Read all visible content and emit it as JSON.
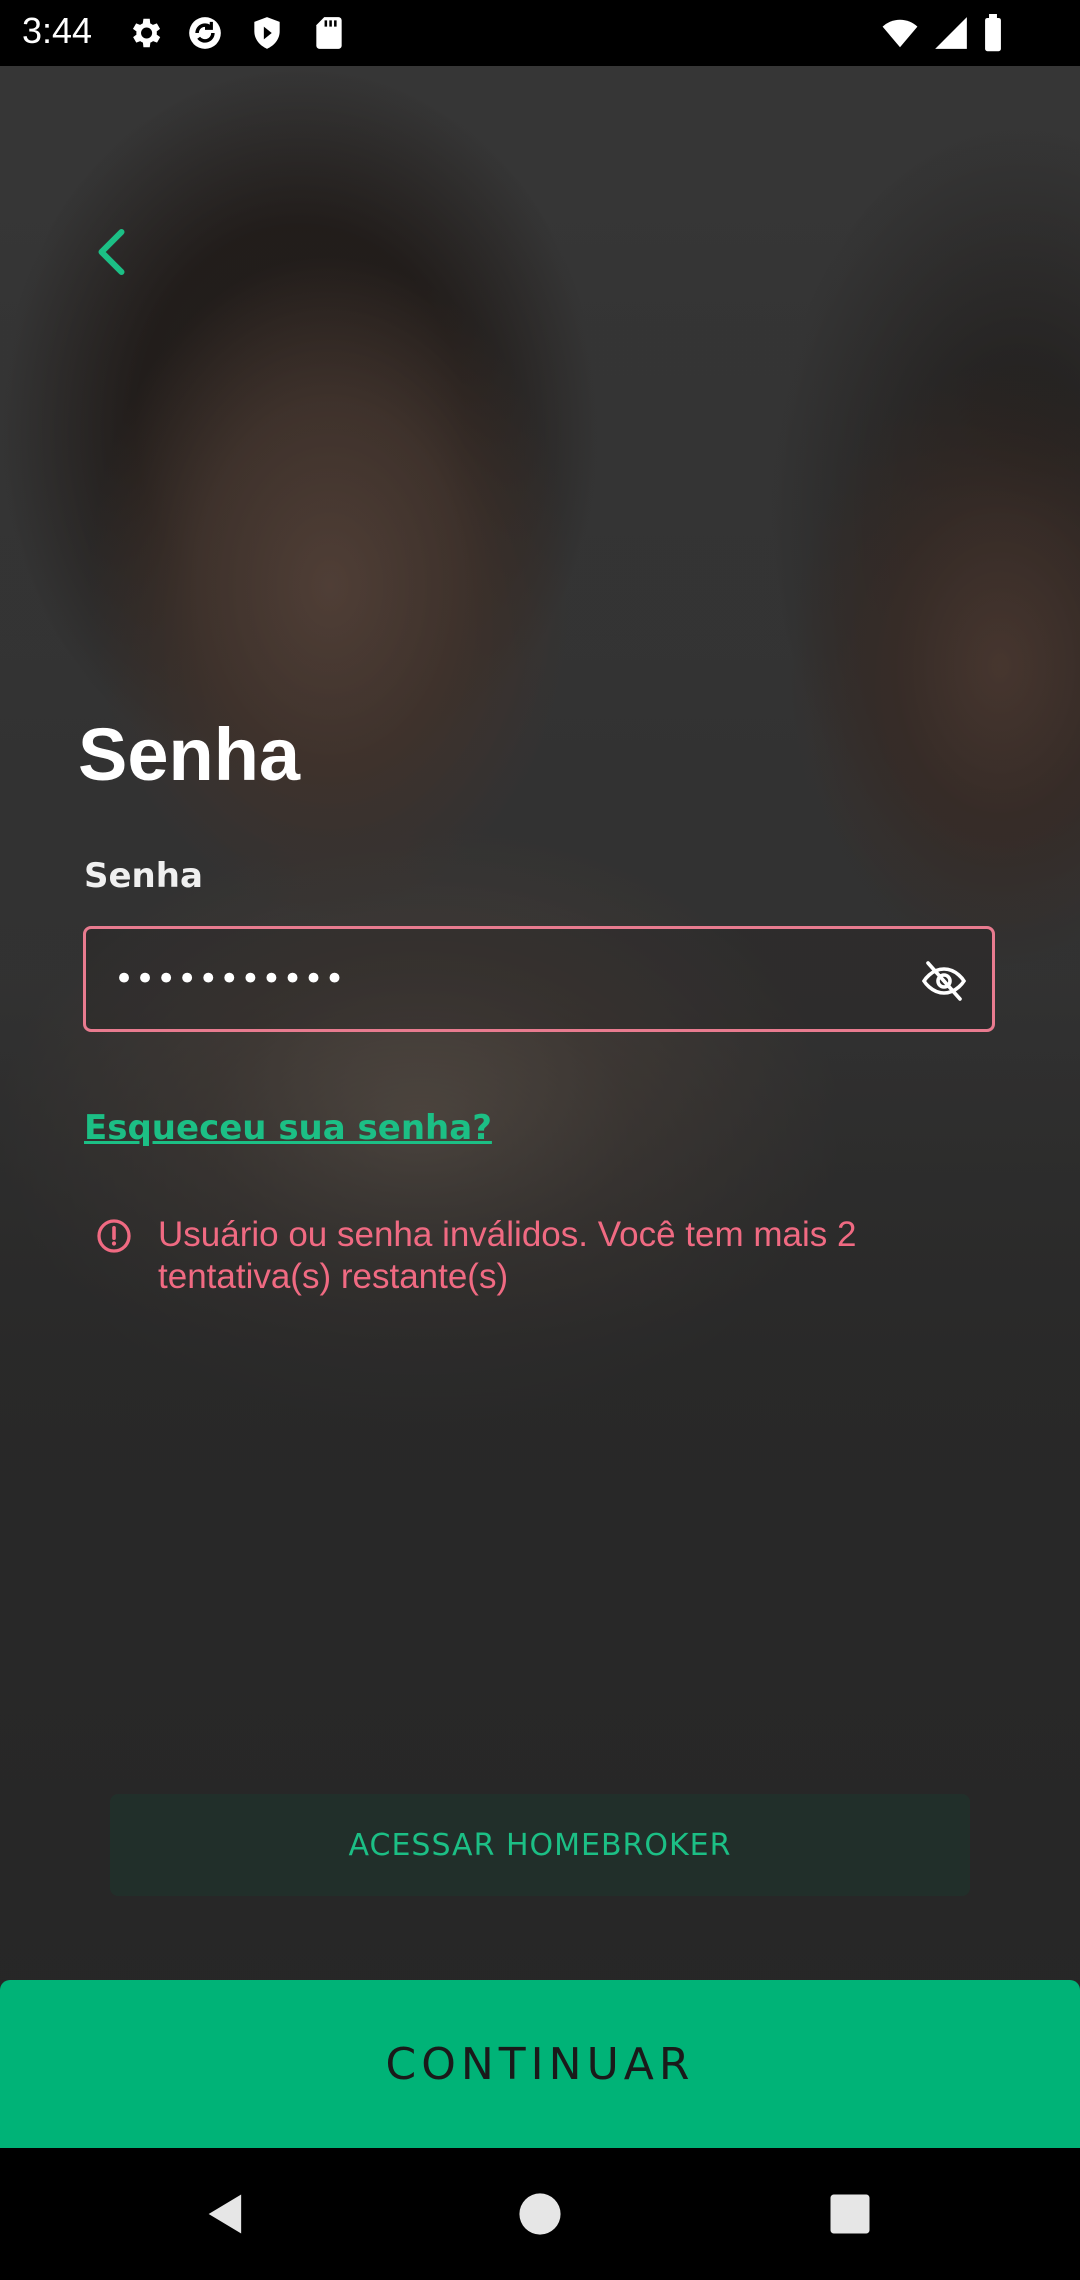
{
  "status_bar": {
    "time": "3:44",
    "left_icons": [
      "gear-icon",
      "sync-icon",
      "shield-play-icon",
      "sd-card-icon"
    ],
    "right_icons": [
      "wifi-icon",
      "signal-icon",
      "battery-icon"
    ]
  },
  "header": {
    "back_icon": "chevron-left-icon"
  },
  "page": {
    "title": "Senha"
  },
  "password_field": {
    "label": "Senha",
    "value": "•••••••••••",
    "visibility_icon": "eye-off-icon"
  },
  "links": {
    "forgot_password": "Esqueceu sua senha?"
  },
  "error": {
    "icon": "alert-circle-icon",
    "message": "Usuário ou senha inválidos. Você tem mais 2 tentativa(s) restante(s)"
  },
  "buttons": {
    "homebroker": "ACESSAR HOMEBROKER",
    "continue": "CONTINUAR"
  },
  "nav_bar": {
    "back": "back-triangle-icon",
    "home": "home-circle-icon",
    "recents": "recents-square-icon"
  },
  "colors": {
    "accent": "#1cbf85",
    "primary_button": "#00b377",
    "error": "#f06a82",
    "error_border": "#e87b8f"
  }
}
